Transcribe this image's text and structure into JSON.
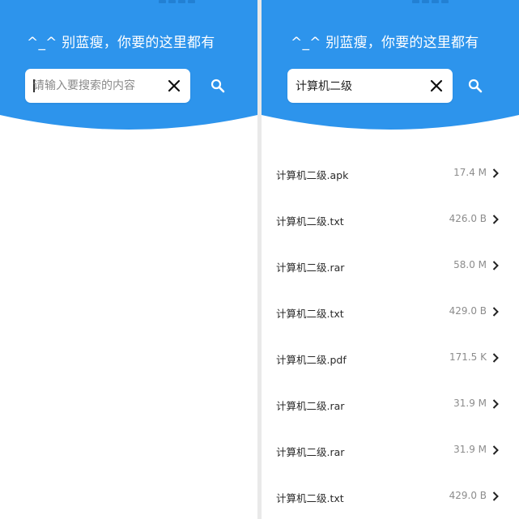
{
  "colors": {
    "header_blue": "#2d94ec",
    "text_dark": "#2a2a2a",
    "text_muted": "#8c8c8c",
    "divider": "#e9e9e9"
  },
  "left_screen": {
    "slogan": "^_^ 别蓝瘦，你要的这里都有",
    "search": {
      "value": "",
      "placeholder": "请输入要搜索的内容",
      "clear_icon": "close-icon",
      "submit_icon": "search-icon"
    }
  },
  "right_screen": {
    "slogan": "^_^ 别蓝瘦，你要的这里都有",
    "search": {
      "value": "计算机二级",
      "placeholder": "请输入要搜索的内容",
      "clear_icon": "close-icon",
      "submit_icon": "search-icon"
    },
    "results": [
      {
        "name": "计算机二级.apk",
        "size": "17.4 M"
      },
      {
        "name": "计算机二级.txt",
        "size": "426.0 B"
      },
      {
        "name": "计算机二级.rar",
        "size": "58.0 M"
      },
      {
        "name": "计算机二级.txt",
        "size": "429.0 B"
      },
      {
        "name": "计算机二级.pdf",
        "size": "171.5 K"
      },
      {
        "name": "计算机二级.rar",
        "size": "31.9 M"
      },
      {
        "name": "计算机二级.rar",
        "size": "31.9 M"
      },
      {
        "name": "计算机二级.txt",
        "size": "429.0 B"
      }
    ]
  }
}
